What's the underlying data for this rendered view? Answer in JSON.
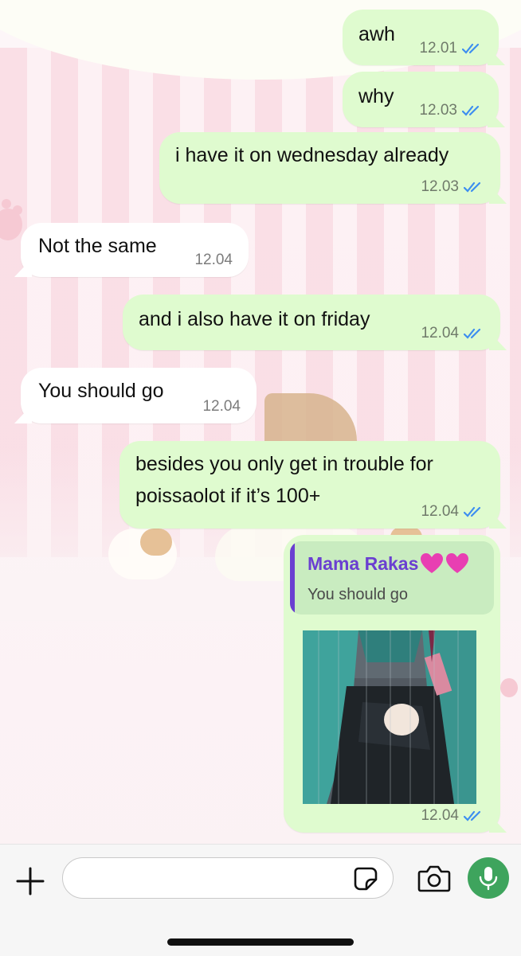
{
  "messages": [
    {
      "direction": "outgoing",
      "text": "awh",
      "time": "12.01",
      "status": "read"
    },
    {
      "direction": "outgoing",
      "text": "why",
      "time": "12.03",
      "status": "read"
    },
    {
      "direction": "outgoing",
      "text": "i have it on wednesday already",
      "time": "12.03",
      "status": "read"
    },
    {
      "direction": "incoming",
      "text": "Not the same",
      "time": "12.04"
    },
    {
      "direction": "outgoing",
      "text": "and i also have it on friday",
      "time": "12.04",
      "status": "read"
    },
    {
      "direction": "incoming",
      "text": "You should go",
      "time": "12.04"
    },
    {
      "direction": "outgoing",
      "lines": [
        "besides you only get in trouble for",
        "poissaolot if it’s 100+"
      ],
      "time": "12.04",
      "status": "read"
    },
    {
      "direction": "outgoing",
      "type": "image-reply",
      "reply": {
        "author": "Mama Rakas",
        "text": "You should go"
      },
      "time": "12.04",
      "status": "read"
    }
  ],
  "input_bar": {
    "placeholder": "",
    "icons": [
      "plus-icon",
      "sticker-icon",
      "camera-icon",
      "microphone-icon"
    ]
  },
  "colors": {
    "outgoing_bubble": "#dffbcf",
    "incoming_bubble": "#ffffff",
    "read_ticks": "#3d8ef0",
    "reply_accent": "#6a3fd1",
    "mic_button": "#3ea45d"
  }
}
